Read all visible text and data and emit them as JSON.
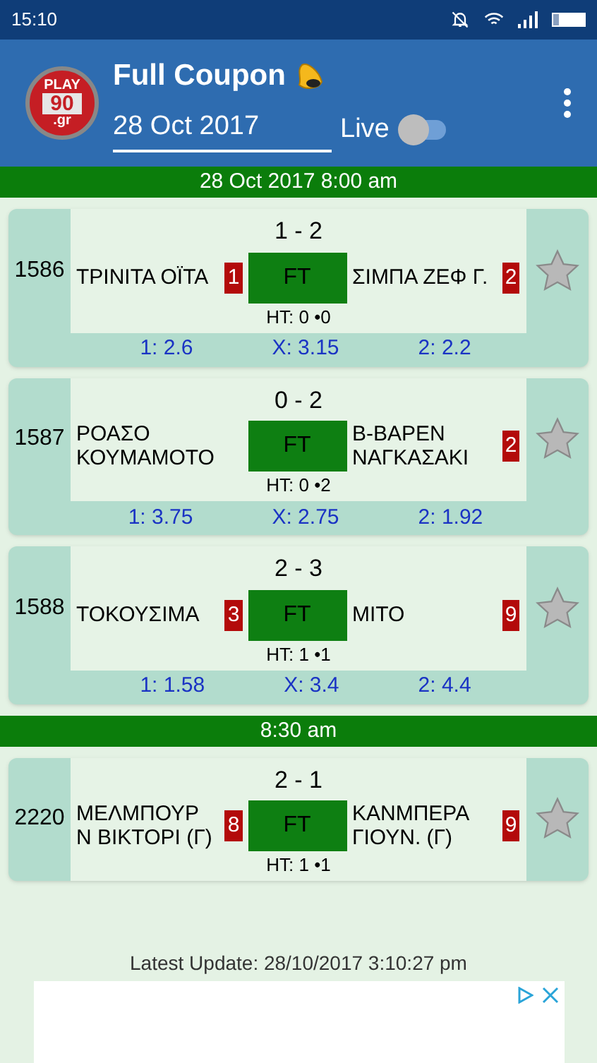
{
  "status_bar": {
    "time": "15:10"
  },
  "header": {
    "title": "Full Coupon",
    "logo": {
      "line_1": "PLAY",
      "line_2": "90",
      "line_3": ".gr"
    },
    "date": "28 Oct 2017",
    "live_label": "Live",
    "live_on": false
  },
  "groups": [
    {
      "heading": "28 Oct 2017 8:00 am",
      "matches": [
        {
          "code": "1586",
          "score": "1 - 2",
          "home": "ΤΡΙΝΙΤΑ ΟΪΤΑ",
          "away": "ΣΙΜΠΑ ΖΕΦ Γ.",
          "home_cards": "1",
          "away_cards": "2",
          "status": "FT",
          "half_time": "HT: 0 •0",
          "favorite": false,
          "odds": [
            "1: 2.6",
            "X: 3.15",
            "2: 2.2"
          ]
        },
        {
          "code": "1587",
          "score": "0 - 2",
          "home": "ΡΟΑΣΟ ΚΟΥΜΑΜΟΤΟ",
          "away": "Β-ΒΑΡΕΝ ΝΑΓΚΑΣΑΚΙ",
          "away_cards": "2",
          "status": "FT",
          "half_time": "HT: 0 •2",
          "favorite": false,
          "odds": [
            "1: 3.75",
            "X: 2.75",
            "2: 1.92"
          ]
        },
        {
          "code": "1588",
          "score": "2 - 3",
          "home": "ΤΟΚΟΥΣΙΜΑ",
          "away": "ΜΙΤΟ",
          "home_cards": "3",
          "away_cards": "9",
          "status": "FT",
          "half_time": "HT: 1 •1",
          "favorite": false,
          "odds": [
            "1: 1.58",
            "X: 3.4",
            "2: 4.4"
          ]
        }
      ]
    },
    {
      "heading": "8:30 am",
      "matches": [
        {
          "code": "2220",
          "score": "2 - 1",
          "home": "ΜΕΛΜΠΟΥΡ Ν ΒΙΚΤΟΡΙ (Γ)",
          "away": "ΚΑΝΜΠΕΡΑ ΓΙΟΥΝ. (Γ)",
          "home_cards": "8",
          "away_cards": "9",
          "status": "FT",
          "half_time": "HT: 1 •1",
          "favorite": false
        }
      ]
    }
  ],
  "footer": {
    "latest_update": "Latest Update: 28/10/2017 3:10:27 pm"
  }
}
